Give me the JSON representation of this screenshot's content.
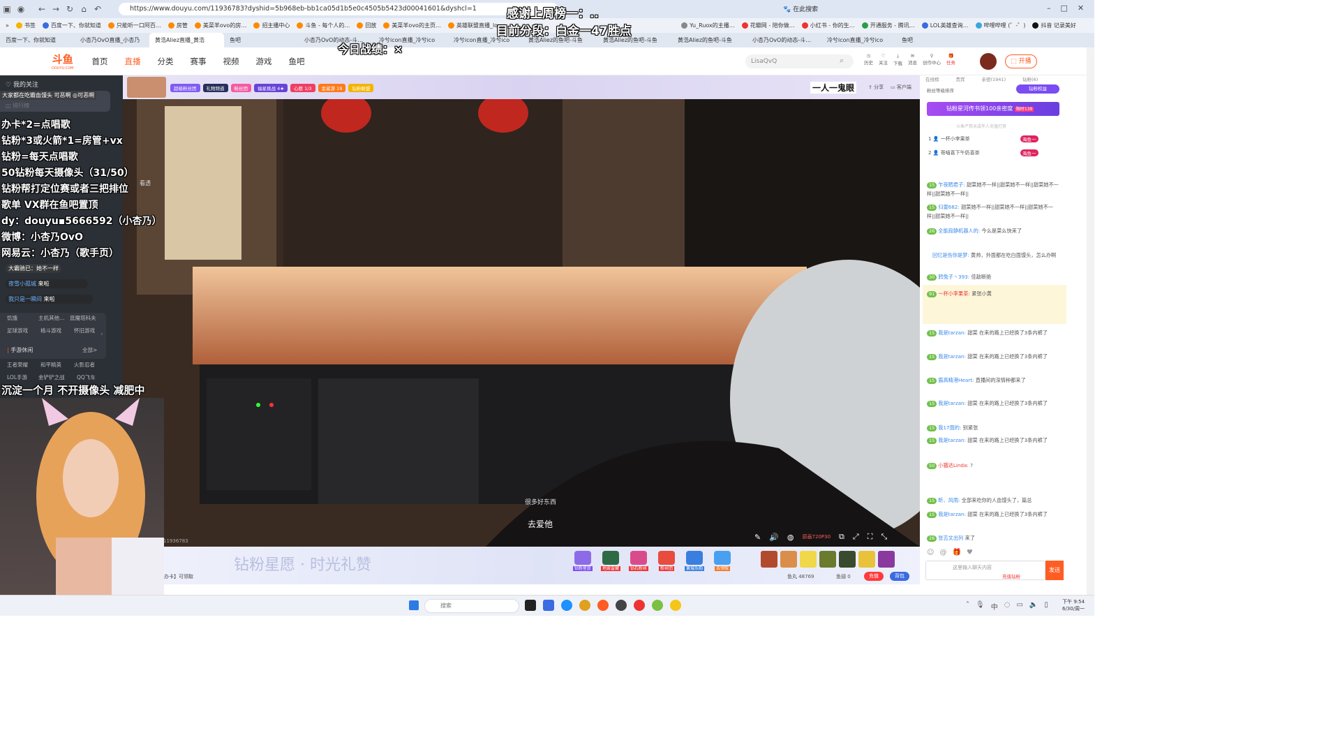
{
  "browser": {
    "url": "https://www.douyu.com/11936783?dyshid=5b968eb-bb1ca05d1b5e0c4505b5423d00041601&dyshcl=1",
    "search_label": "在此搜索",
    "bookmarks": [
      "书签",
      "百度一下、你就知道",
      "只能听一口阿百…",
      "房管",
      "美菜羊ovo的房…",
      "招主播中心",
      "斗鱼 - 每个人的…",
      "回放",
      "美菜羊ovo的主页…",
      "英雄联盟直播_lo…",
      "排行",
      "Yu_Ruox的主播…",
      "花瓣网 - 陪你做…",
      "小红书 - 你的生…",
      "开通服务 - 腾讯…",
      "LOL英雄查询…",
      "哔哩哔哩 (゜-゜)",
      "抖音 记录美好"
    ],
    "tabs": [
      "百度一下、你就知道",
      "小杏乃OvO直播_小杏乃",
      "黄浩Aliez直播_黄浩",
      "鱼吧",
      "小杏乃OvO的动态-斗…",
      "冷兮icon直播_冷兮ico",
      "冷兮icon直播_冷兮ico",
      "黄浩Aliez的鱼吧-斗鱼",
      "黄浩Aliez的鱼吧-斗鱼",
      "黄浩Aliez的鱼吧-斗鱼",
      "小杏乃OvO的动态-斗…",
      "冷兮icon直播_冷兮ico",
      "鱼吧"
    ]
  },
  "site": {
    "logo": "斗鱼",
    "logo_sub": "DOUYU.COM",
    "nav": [
      "首页",
      "直播",
      "分类",
      "赛事",
      "视频",
      "游戏",
      "鱼吧"
    ],
    "search_placeholder": "LisaQvQ",
    "header_icons": [
      "历史",
      "关注",
      "下载",
      "消息",
      "创作中心",
      "任务"
    ],
    "open_live": "开播"
  },
  "sidebar": {
    "follow_label": "我的关注",
    "rank_label": "排行榜",
    "categories": [
      [
        "饥饿",
        "主机其他…",
        "逛魔塔科夫"
      ],
      [
        "足球游戏",
        "格斗游戏",
        "怀旧游戏"
      ]
    ],
    "mobile_title": "手游休闲",
    "more": "全部>",
    "mobile_games": [
      [
        "王者荣耀",
        "和平精英",
        "火影忍者"
      ],
      [
        "LOL手游",
        "金铲铲之战",
        "QQ飞车"
      ]
    ]
  },
  "overlay": {
    "rank_thanks": "感谢上周榜一：..",
    "rank_current": "目前分段：白金一47胜点",
    "today_record": "今日战绩：×",
    "rules": [
      "办卡*2=点唱歌",
      "钻粉*3或火箭*1=房管+vx",
      "钻粉=每天点唱歌",
      "50钻粉每天摄像头（31/50）",
      "钻粉帮打定位赛或者三把排位",
      "歌单 VX群在鱼吧置顶",
      "dy：douyu▪5666592（小杏乃）",
      "微博：小杏乃OvO",
      "网易云：小杏乃（歌手页）"
    ],
    "notice": "沉淀一个月 不开摄像头 减肥中",
    "barrage_1": "大家都在吃瓣血馒头 可恶啊 ◎可恶啊",
    "barrage_2": "大霸驰已：她不一样",
    "enter_1_name": "夜雪小孤城",
    "enter_1_text": "来啦",
    "enter_2_name": "我只是一瞬间",
    "enter_2_text": "来啦",
    "streamer_text": "看透"
  },
  "player": {
    "badges": [
      "超级粉丝团",
      "礼物频道",
      "粉丝团",
      "福星挑战 4★",
      "心愿 1/3",
      "金鲨游 19",
      "钻粉联盟"
    ],
    "title_tag": "一人一鬼眼",
    "share": "分享",
    "client": "客户端",
    "subtitle_small": "很多好东西",
    "subtitle": "去爱他",
    "quality": "原画720P30",
    "room_id": "11936783"
  },
  "gift_bar": {
    "banner": "钻粉星愿 · 时光礼赞",
    "gifts": [
      "钻粉星愿",
      "地震雷藏",
      "钻石粉丝",
      "粉丝团",
      "黄城乐韵",
      "去领取"
    ],
    "chat_hint": "办卡】可领取",
    "balance_fish_ball": "鱼丸 48769",
    "balance_fish_wing": "鱼翅 0",
    "recharge": "充值",
    "backpack": "背包"
  },
  "right": {
    "tabs": [
      "在线榜",
      "贵宾",
      "亲密(1941)",
      "钻粉(6)"
    ],
    "fan_rank": "粉丝等级排序",
    "diamond_privilege": "钻粉权益",
    "promo_banner": "钻粉星河传书领100亲密度",
    "promo_tag": "限时138",
    "promo_note": "斗鱼严禁未成年人充值打赏",
    "ranks": [
      {
        "rank": "1",
        "name": "一杯小李果茶",
        "tag": "海鱼一"
      },
      {
        "rank": "2",
        "name": "哥喵喜下午奶喜茶",
        "tag": "海鱼一"
      }
    ],
    "chat": [
      {
        "lv": "15",
        "name": "乍夜晒君子:",
        "text": "甜菜她不一样||甜菜她不一样||甜菜她不一样||甜菜她不一样||"
      },
      {
        "lv": "15",
        "name": "归雷682:",
        "text": "甜菜她不一样||甜菜她不一样||甜菜她不一样||甜菜她不一样||"
      },
      {
        "lv": "26",
        "name": "全能寂静机器人的:",
        "text": "今么是菜么快来了"
      },
      {
        "lv": "",
        "name": "回忆是伤你是梦:",
        "text": "黄帅，外面都在吃白面馒头，怎么办啊"
      },
      {
        "lv": "30",
        "name": "鸦兔子丶393:",
        "text": "佳敌断绝"
      },
      {
        "lv": "91",
        "name": "一杯小李果茶:",
        "text": "紧张小黄"
      },
      {
        "lv": "15",
        "name": "我是tarzan:",
        "text": "甜菜 在来的路上已经换了3条内裤了"
      },
      {
        "lv": "15",
        "name": "我是tarzan:",
        "text": "甜菜 在来的路上已经换了3条内裤了"
      },
      {
        "lv": "15",
        "name": "霸高精港Heart:",
        "text": "直播间的深情种都来了"
      },
      {
        "lv": "15",
        "name": "我是tarzan:",
        "text": "甜菜 在来的路上已经换了3条内裤了"
      },
      {
        "lv": "15",
        "name": "我是tarzan:",
        "text": "甜菜 在来的路上已经换了3条内裤了"
      },
      {
        "lv": "15",
        "name": "我17面的:",
        "text": "别紧张"
      },
      {
        "lv": "15",
        "name": "我是tarzan:",
        "text": "甜菜 在来的路上已经换了3条内裤了"
      },
      {
        "lv": "50",
        "name": "小猫达Linda:",
        "text": "?"
      },
      {
        "lv": "15",
        "name": "昕、风雨:",
        "text": "全部来吃你的人血馒头了，篇总"
      },
      {
        "lv": "15",
        "name": "我是tarzan:",
        "text": "甜菜 在来的路上已经换了3条内裤了"
      },
      {
        "lv": "26",
        "name": "张吉文出列",
        "text": "来了"
      }
    ],
    "chat_placeholder": "这里输入聊天内容",
    "send": "发送",
    "recharge_hint": "充值钻粉"
  },
  "taskbar": {
    "search_placeholder": "搜索",
    "time": "下午 9:54",
    "date": "6/30/周一"
  },
  "colors": {
    "brand": "#ff5d23",
    "chat_name": "#3b8be8",
    "level": "#72c04b"
  }
}
